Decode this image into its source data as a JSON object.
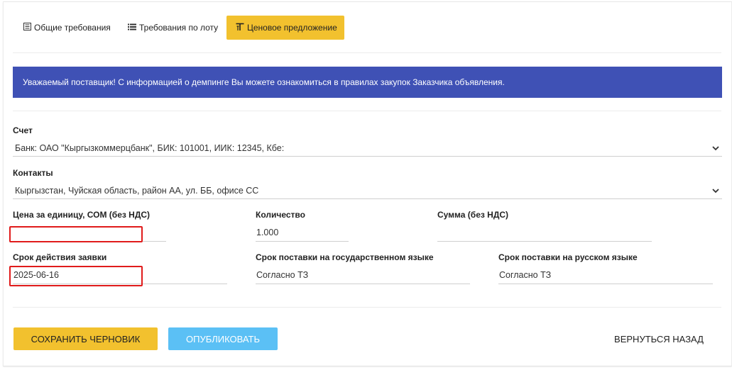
{
  "tabs": [
    {
      "label": "Общие требования",
      "icon": "document-list-icon"
    },
    {
      "label": "Требования по лоту",
      "icon": "list-icon"
    },
    {
      "label": "Ценовое предложение",
      "icon": "price-text-icon"
    }
  ],
  "banner": {
    "text": "Уважаемый поставщик! С информацией о демпинге Вы можете ознакомиться в правилах закупок Заказчика объявления.",
    "color": "#3f51b5"
  },
  "account": {
    "label": "Счет",
    "value": "Банк: ОАО \"Кыргызкоммерцбанк\", БИК: 101001, ИИК: 12345, Кбе:"
  },
  "contacts": {
    "label": "Контакты",
    "value": "Кыргызстан, Чуйская область, район АА, ул. ББ, офисе СС"
  },
  "unit_price": {
    "label": "Цена за единицу, СОМ (без НДС)",
    "value": ""
  },
  "quantity": {
    "label": "Количество",
    "value": "1.000"
  },
  "sum": {
    "label": "Сумма (без НДС)",
    "value": ""
  },
  "validity": {
    "label": "Срок действия заявки",
    "value": "2025-06-16"
  },
  "delivery_state": {
    "label": "Срок поставки на государственном языке",
    "value": "Согласно ТЗ"
  },
  "delivery_ru": {
    "label": "Срок поставки на русском языке",
    "value": "Согласно ТЗ"
  },
  "buttons": {
    "save": "СОХРАНИТЬ ЧЕРНОВИК",
    "publish": "ОПУБЛИКОВАТЬ",
    "back": "ВЕРНУТЬСЯ НАЗАД"
  },
  "colors": {
    "accent_yellow": "#f2c12e",
    "publish_blue": "#5bc0f5",
    "highlight_red": "#e01b1b"
  }
}
